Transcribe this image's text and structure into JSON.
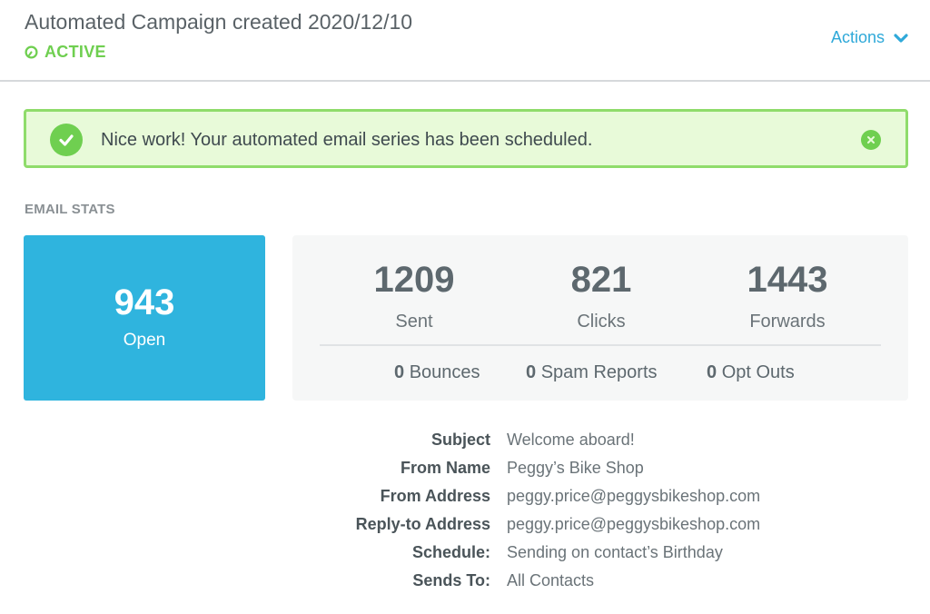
{
  "header": {
    "title": "Automated Campaign created 2020/12/10",
    "status": "ACTIVE",
    "status_icon": "clock-icon",
    "actions_label": "Actions",
    "actions_icon": "chevron-down-icon"
  },
  "alert": {
    "icon": "check-circle-icon",
    "message": "Nice work! Your automated email series has been scheduled.",
    "close_icon": "close-icon"
  },
  "email_stats": {
    "section_label": "EMAIL STATS",
    "open": {
      "value": "943",
      "label": "Open"
    },
    "primary": [
      {
        "value": "1209",
        "label": "Sent"
      },
      {
        "value": "821",
        "label": "Clicks"
      },
      {
        "value": "1443",
        "label": "Forwards"
      }
    ],
    "secondary": [
      {
        "value": "0",
        "label": "Bounces"
      },
      {
        "value": "0",
        "label": "Spam Reports"
      },
      {
        "value": "0",
        "label": "Opt Outs"
      }
    ]
  },
  "details": [
    {
      "label": "Subject",
      "value": "Welcome aboard!"
    },
    {
      "label": "From Name",
      "value": "Peggy’s Bike Shop"
    },
    {
      "label": "From Address",
      "value": "peggy.price@peggysbikeshop.com"
    },
    {
      "label": "Reply-to Address",
      "value": "peggy.price@peggysbikeshop.com"
    },
    {
      "label": "Schedule:",
      "value": "Sending on contact’s Birthday"
    },
    {
      "label": "Sends To:",
      "value": "All Contacts"
    }
  ],
  "colors": {
    "accent_blue": "#2fb4de",
    "link_blue": "#2fa9d9",
    "success_green": "#6fcf50",
    "alert_bg": "#e8fad9",
    "alert_border": "#8fdc6b"
  }
}
